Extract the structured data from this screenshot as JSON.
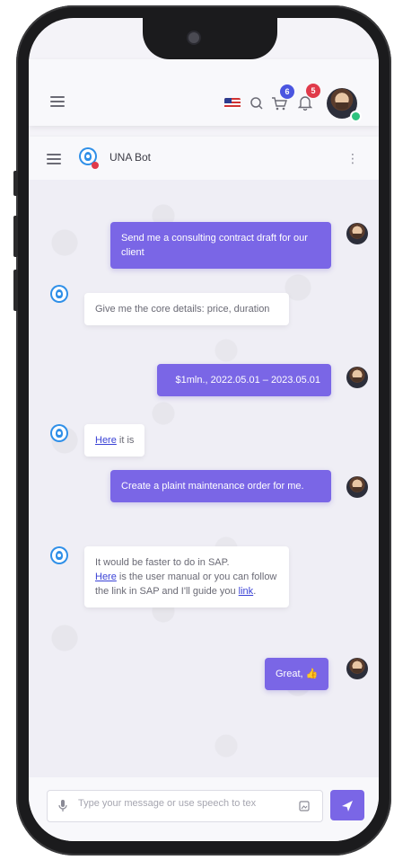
{
  "app": {
    "flag_icon": "us-flag-icon",
    "cart_badge": "6",
    "notifications_badge": "5",
    "badge_colors": {
      "cart": "#4a55e0",
      "notifications": "#e03a4a"
    }
  },
  "chat_header": {
    "bot_name": "UNA Bot"
  },
  "messages": [
    {
      "from": "user",
      "text": "Send me a consulting contract draft for our client"
    },
    {
      "from": "bot",
      "text": "Give me the core details: price, duration"
    },
    {
      "from": "user",
      "text": "$1mln., 2022.05.01 – 2023.05.01"
    },
    {
      "from": "bot",
      "link": "Here",
      "rest": " it is"
    },
    {
      "from": "user",
      "text": "Create a plaint maintenance order for me."
    },
    {
      "from": "bot",
      "pre": "It would be faster to do in SAP.",
      "link1": "Here",
      "mid": " is the user manual or you can follow the link in SAP and I'll guide you ",
      "link2": "link",
      "post": "."
    },
    {
      "from": "user",
      "text": "Great,",
      "emoji": "👍"
    }
  ],
  "composer": {
    "placeholder": "Type your message or use speech to tex",
    "send_icon": "send-icon"
  },
  "colors": {
    "accent": "#7a66e6",
    "bot": "#2f8fe8"
  }
}
